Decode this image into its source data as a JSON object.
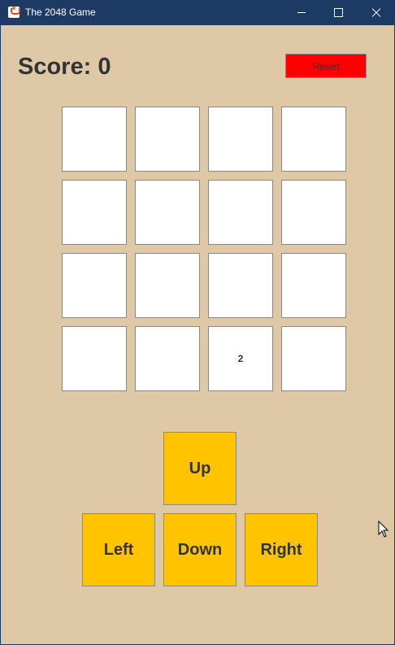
{
  "window": {
    "title": "The 2048 Game"
  },
  "header": {
    "score_label": "Score: 0",
    "reset_label": "Reset"
  },
  "board": [
    [
      "",
      "",
      "",
      ""
    ],
    [
      "",
      "",
      "",
      ""
    ],
    [
      "",
      "",
      "",
      ""
    ],
    [
      "",
      "",
      "2",
      ""
    ]
  ],
  "controls": {
    "up": "Up",
    "left": "Left",
    "down": "Down",
    "right": "Right"
  },
  "colors": {
    "background": "#dfc8a6",
    "titlebar": "#1c3a63",
    "reset": "#ff0000",
    "direction_button": "#ffc300",
    "tile": "#ffffff"
  }
}
